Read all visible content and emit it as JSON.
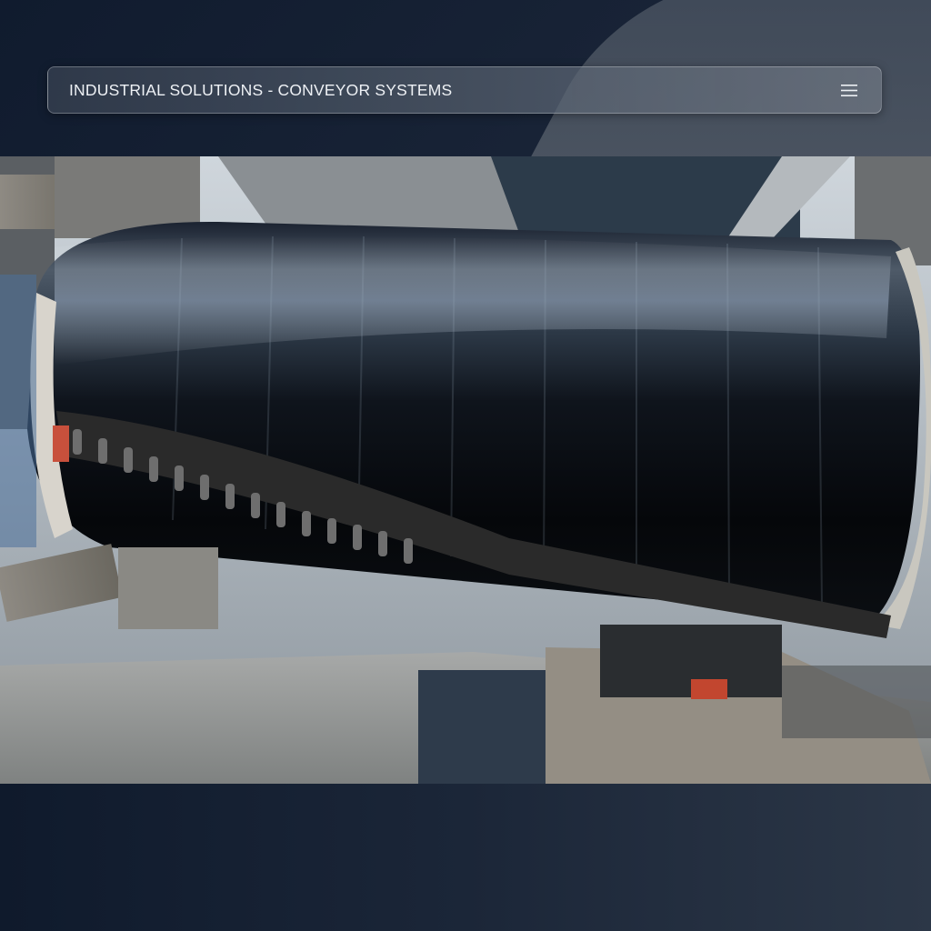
{
  "header": {
    "title": "INDUSTRIAL SOLUTIONS - CONVEYOR SYSTEMS",
    "menu_icon": "hamburger-menu-icon"
  },
  "hero_image": {
    "content": "conveyor-pulley-photo"
  },
  "colors": {
    "background_dark": "#101b2e",
    "background_light": "#2b3647",
    "header_text": "#eef1f5"
  }
}
